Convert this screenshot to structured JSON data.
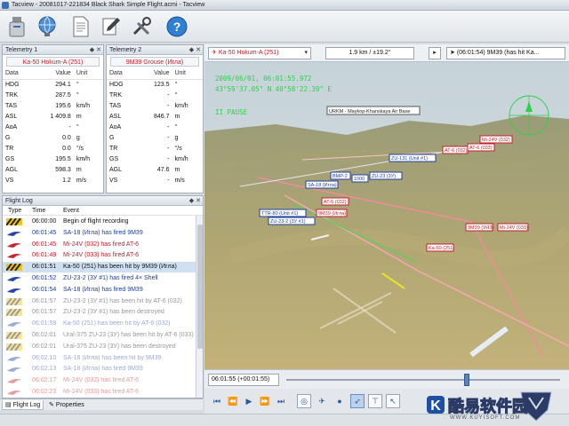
{
  "window": {
    "title": "Tacview - 20081017-221834 Black Shark Simple Flight.acmi - Tacview"
  },
  "toolbar": {
    "buttons": [
      {
        "name": "open-usb-button",
        "icon": "usb-drive-icon"
      },
      {
        "name": "network-button",
        "icon": "globe-icon"
      },
      {
        "name": "document-button",
        "icon": "document-icon"
      },
      {
        "name": "edit-button",
        "icon": "pencil-icon"
      },
      {
        "name": "tools-button",
        "icon": "tools-icon"
      },
      {
        "name": "help-button",
        "icon": "help-icon"
      }
    ]
  },
  "telemetry1": {
    "title": "Telemetry 1",
    "object": "Ka-50 Hokum-A (251)",
    "headers": [
      "Data",
      "Value",
      "Unit"
    ],
    "rows": [
      [
        "HDG",
        "294.1",
        "°"
      ],
      [
        "TRK",
        "287.5",
        "°"
      ],
      [
        "TAS",
        "195.6",
        "km/h"
      ],
      [
        "ASL",
        "1 409.8",
        "m"
      ],
      [
        "AoA",
        "-",
        "°"
      ],
      [
        "G",
        "0.0",
        "g"
      ],
      [
        "TR",
        "0.0",
        "°/s"
      ],
      [
        "GS",
        "195.5",
        "km/h"
      ],
      [
        "AGL",
        "598.3",
        "m"
      ],
      [
        "VS",
        "1.2",
        "m/s"
      ]
    ]
  },
  "telemetry2": {
    "title": "Telemetry 2",
    "object": "9M39 Grouse (Игла)",
    "headers": [
      "Data",
      "Value",
      "Unit"
    ],
    "rows": [
      [
        "HDG",
        "123.5",
        "°"
      ],
      [
        "TRK",
        "-",
        "°"
      ],
      [
        "TAS",
        "-",
        "km/h"
      ],
      [
        "ASL",
        "846.7",
        "m"
      ],
      [
        "AoA",
        "-",
        "°"
      ],
      [
        "G",
        "-",
        "g"
      ],
      [
        "TR",
        "-",
        "°/s"
      ],
      [
        "GS",
        "-",
        "km/h"
      ],
      [
        "AGL",
        "47.6",
        "m"
      ],
      [
        "VS",
        "-",
        "m/s"
      ]
    ]
  },
  "flight_log": {
    "title": "Flight Log",
    "headers": [
      "Type",
      "Time",
      "Event"
    ],
    "rows": [
      {
        "icon": "hazard",
        "time": "06:00:00",
        "event": "Begin of flight recording",
        "color": "#111111",
        "faded": false
      },
      {
        "icon": "jet-blue",
        "time": "06:01:45",
        "event": "SA-18 (Игла) has fired 9M39",
        "color": "#1e3f9a",
        "faded": false
      },
      {
        "icon": "jet-red",
        "time": "06:01:45",
        "event": "Mi-24V (032) has fired AT-6",
        "color": "#c0202a",
        "faded": false
      },
      {
        "icon": "jet-red",
        "time": "06:01:49",
        "event": "Mi-24V (033) has fired AT-6",
        "color": "#c0202a",
        "faded": false
      },
      {
        "icon": "hazard",
        "time": "06:01:51",
        "event": "Ka-50 (251) has been hit by 9M39 (Игла)",
        "color": "#111111",
        "faded": false
      },
      {
        "icon": "jet-blue",
        "time": "06:01:52",
        "event": "ZU-23-2 (3У #1) has fired 4× Shell",
        "color": "#1e3f9a",
        "faded": false
      },
      {
        "icon": "jet-blue",
        "time": "06:01:54",
        "event": "SA-18 (Игла) has fired 9M39",
        "color": "#1e3f9a",
        "faded": false
      },
      {
        "icon": "hazard",
        "time": "06:01:57",
        "event": "ZU-23-2 (3У #1) has been hit by AT-6 (032)",
        "color": "#111111",
        "faded": true
      },
      {
        "icon": "hazard",
        "time": "06:01:57",
        "event": "ZU-23-2 (3У #1) has been destroyed",
        "color": "#111111",
        "faded": true
      },
      {
        "icon": "jet-blue",
        "time": "06:01:59",
        "event": "Ka-50 (251) has been hit by AT-6 (032)",
        "color": "#1e3f9a",
        "faded": true
      },
      {
        "icon": "hazard",
        "time": "06:02:01",
        "event": "Ural-375 ZU-23 (3У) has been hit by AT-6 (033)",
        "color": "#111111",
        "faded": true
      },
      {
        "icon": "hazard",
        "time": "06:02:01",
        "event": "Ural-375 ZU-23 (3У) has been destroyed",
        "color": "#111111",
        "faded": true
      },
      {
        "icon": "jet-blue",
        "time": "06:02:10",
        "event": "SA-18 (Игла) has been hit by 9M39",
        "color": "#1e3f9a",
        "faded": true
      },
      {
        "icon": "jet-blue",
        "time": "06:02:13",
        "event": "SA-18 (Игла) has fired 9M39",
        "color": "#1e3f9a",
        "faded": true
      },
      {
        "icon": "jet-red",
        "time": "06:02:17",
        "event": "Mi-24V (032) has fired AT-6",
        "color": "#c0202a",
        "faded": true
      },
      {
        "icon": "jet-red",
        "time": "06:02:23",
        "event": "Mi-24V (033) has fired AT-6",
        "color": "#c0202a",
        "faded": true
      }
    ]
  },
  "bottom_tabs": {
    "flight_log": "Flight Log",
    "properties": "Properties"
  },
  "view_toolbar": {
    "object_select": "Ka-50 Hokum-A (251)",
    "speed": "1.9 km / ±19.2°",
    "target_select": "(06:01:54) 9M39 (has hit Ka..."
  },
  "hud": {
    "date_time": "2009/06/01, 06:01:55.972",
    "coords": "43°59'37.05\" N  40°58'22.39\" E",
    "status": "II PAUSE",
    "airbase_label": "URKM - Maykop-Khanskaya Air Base",
    "color": "#2fd04c"
  },
  "scene_labels": {
    "red": [
      "Mi-24V (032)",
      "AT-6 (033)",
      "AT-6 (032)",
      "AT-6 (032)",
      "Ka-50 (251)",
      "Mi-24V (033)",
      "9M39 (Игла)",
      "9M39 (9ЯЗ)"
    ],
    "blue": [
      "ZU-131 (Unit #1)",
      "BMP-2",
      "ZU-23 (3У)",
      "1000",
      "TTR-80 (Unit #1)",
      "ZU-23-2 (3У #1)",
      "SA-18 (Игла)"
    ]
  },
  "timeline": {
    "time": "06:01:55 (+00:01:55)",
    "position": 0.66
  },
  "colors": {
    "accent": "#2c5aa0",
    "red_label": "#c0202a",
    "blue_label": "#1e3f9a",
    "hud_green": "#2fd04c"
  },
  "watermark": {
    "text": "酷易软件园",
    "url": "WWW.KUYISOFT.COM"
  }
}
